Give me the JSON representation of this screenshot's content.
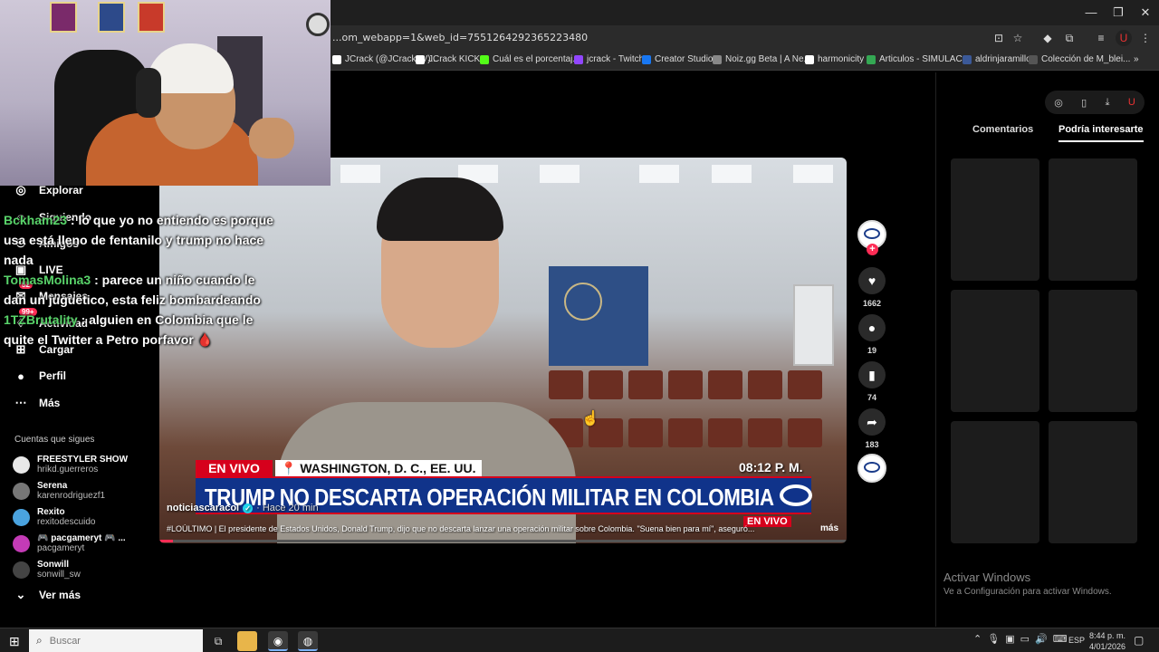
{
  "browser": {
    "url": "...om_webapp=1&web_id=7551264292365223480",
    "bookmarks": [
      {
        "label": "JCrack (@JCrackTV)...",
        "color": "#ffffff"
      },
      {
        "label": "JCrack KICKS",
        "color": "#ffffff"
      },
      {
        "label": "Cuál es el porcentaj...",
        "color": "#53fc18"
      },
      {
        "label": "jcrack - Twitch",
        "color": "#9146ff"
      },
      {
        "label": "Creator Studio",
        "color": "#1877f2"
      },
      {
        "label": "Noiz.gg Beta | A Ne...",
        "color": "#888888"
      },
      {
        "label": "harmonicity",
        "color": "#ffffff"
      },
      {
        "label": "Articulos - SIMULAC...",
        "color": "#34a853"
      },
      {
        "label": "aldrinjaramillo",
        "color": "#3b5998"
      },
      {
        "label": "Colección de M_blei...",
        "color": "#555555"
      }
    ],
    "more_bookmarks": "»"
  },
  "sidebar": {
    "items": [
      {
        "icon": "compass-icon",
        "glyph": "◎",
        "label": "Explorar"
      },
      {
        "icon": "follow-icon",
        "glyph": "☺",
        "label": "Siguiendo"
      },
      {
        "icon": "friends-icon",
        "glyph": "⚇",
        "label": "Amigos"
      },
      {
        "icon": "live-icon",
        "glyph": "▣",
        "label": "LIVE"
      },
      {
        "icon": "message-icon",
        "glyph": "✉",
        "label": "Mensajes",
        "badge": "52"
      },
      {
        "icon": "activity-icon",
        "glyph": "♢",
        "label": "Actividad",
        "badge": "99+"
      },
      {
        "icon": "upload-icon",
        "glyph": "⊞",
        "label": "Cargar"
      },
      {
        "icon": "profile-icon",
        "glyph": "●",
        "label": "Perfil"
      },
      {
        "icon": "more-icon",
        "glyph": "⋯",
        "label": "Más"
      }
    ],
    "follows_title": "Cuentas que sigues",
    "follows": [
      {
        "name": "FREESTYLER SHOW",
        "handle": "hrikd.guerreros",
        "color": "#e8e8e8"
      },
      {
        "name": "Serena",
        "handle": "karenrodriguezf1",
        "color": "#777777"
      },
      {
        "name": "Rexito",
        "handle": "rexitodescuido",
        "color": "#4aa3df"
      },
      {
        "name": "🎮 pacgameryt 🎮 ...",
        "handle": "pacgameryt",
        "color": "#c43bb6"
      },
      {
        "name": "Sonwill",
        "handle": "sonwill_sw",
        "color": "#444444"
      }
    ],
    "see_more": "Ver más"
  },
  "chat": [
    {
      "user": "Bckham23",
      "text": " : lo que yo no entiendo es porque usa está lleno de fentanilo y trump no hace nada"
    },
    {
      "user": "TomasMolina3",
      "text": " : parece un niño cuando le dan un juguetico, esta feliz bombardeando"
    },
    {
      "user": "1TZBrutality",
      "text": " : alguien en Colombia que le quite el Twitter a Petro porfavor 🩸"
    }
  ],
  "video": {
    "live_tag": "EN VIVO",
    "location": "📍 WASHINGTON, D. C., EE. UU.",
    "time": "08:12 P. M.",
    "headline": "TRUMP NO DESCARTA OPERACIÓN MILITAR EN COLOMBIA",
    "live_tag2": "EN VIVO",
    "author": "noticiascaracol",
    "posted": "· Hace 20 min",
    "description": "#LOÚLTIMO | El presidente de Estados Unidos, Donald Trump, dijo que no descarta lanzar una operación militar sobre Colombia. \"Suena bien para mí\", aseguró...",
    "more_label": "más",
    "progress": 0.02
  },
  "rail": {
    "likes": "1662",
    "comments": "19",
    "saves": "74",
    "shares": "183",
    "follow_plus": "+"
  },
  "right_panel": {
    "tabs": [
      "Comentarios",
      "Podría interesarte"
    ],
    "activate_title": "Activar Windows",
    "activate_sub": "Ve a Configuración para activar Windows."
  },
  "taskbar": {
    "search_placeholder": "Buscar",
    "lang": "ESP",
    "time": "8:44 p. m.",
    "date": "4/01/2026"
  }
}
